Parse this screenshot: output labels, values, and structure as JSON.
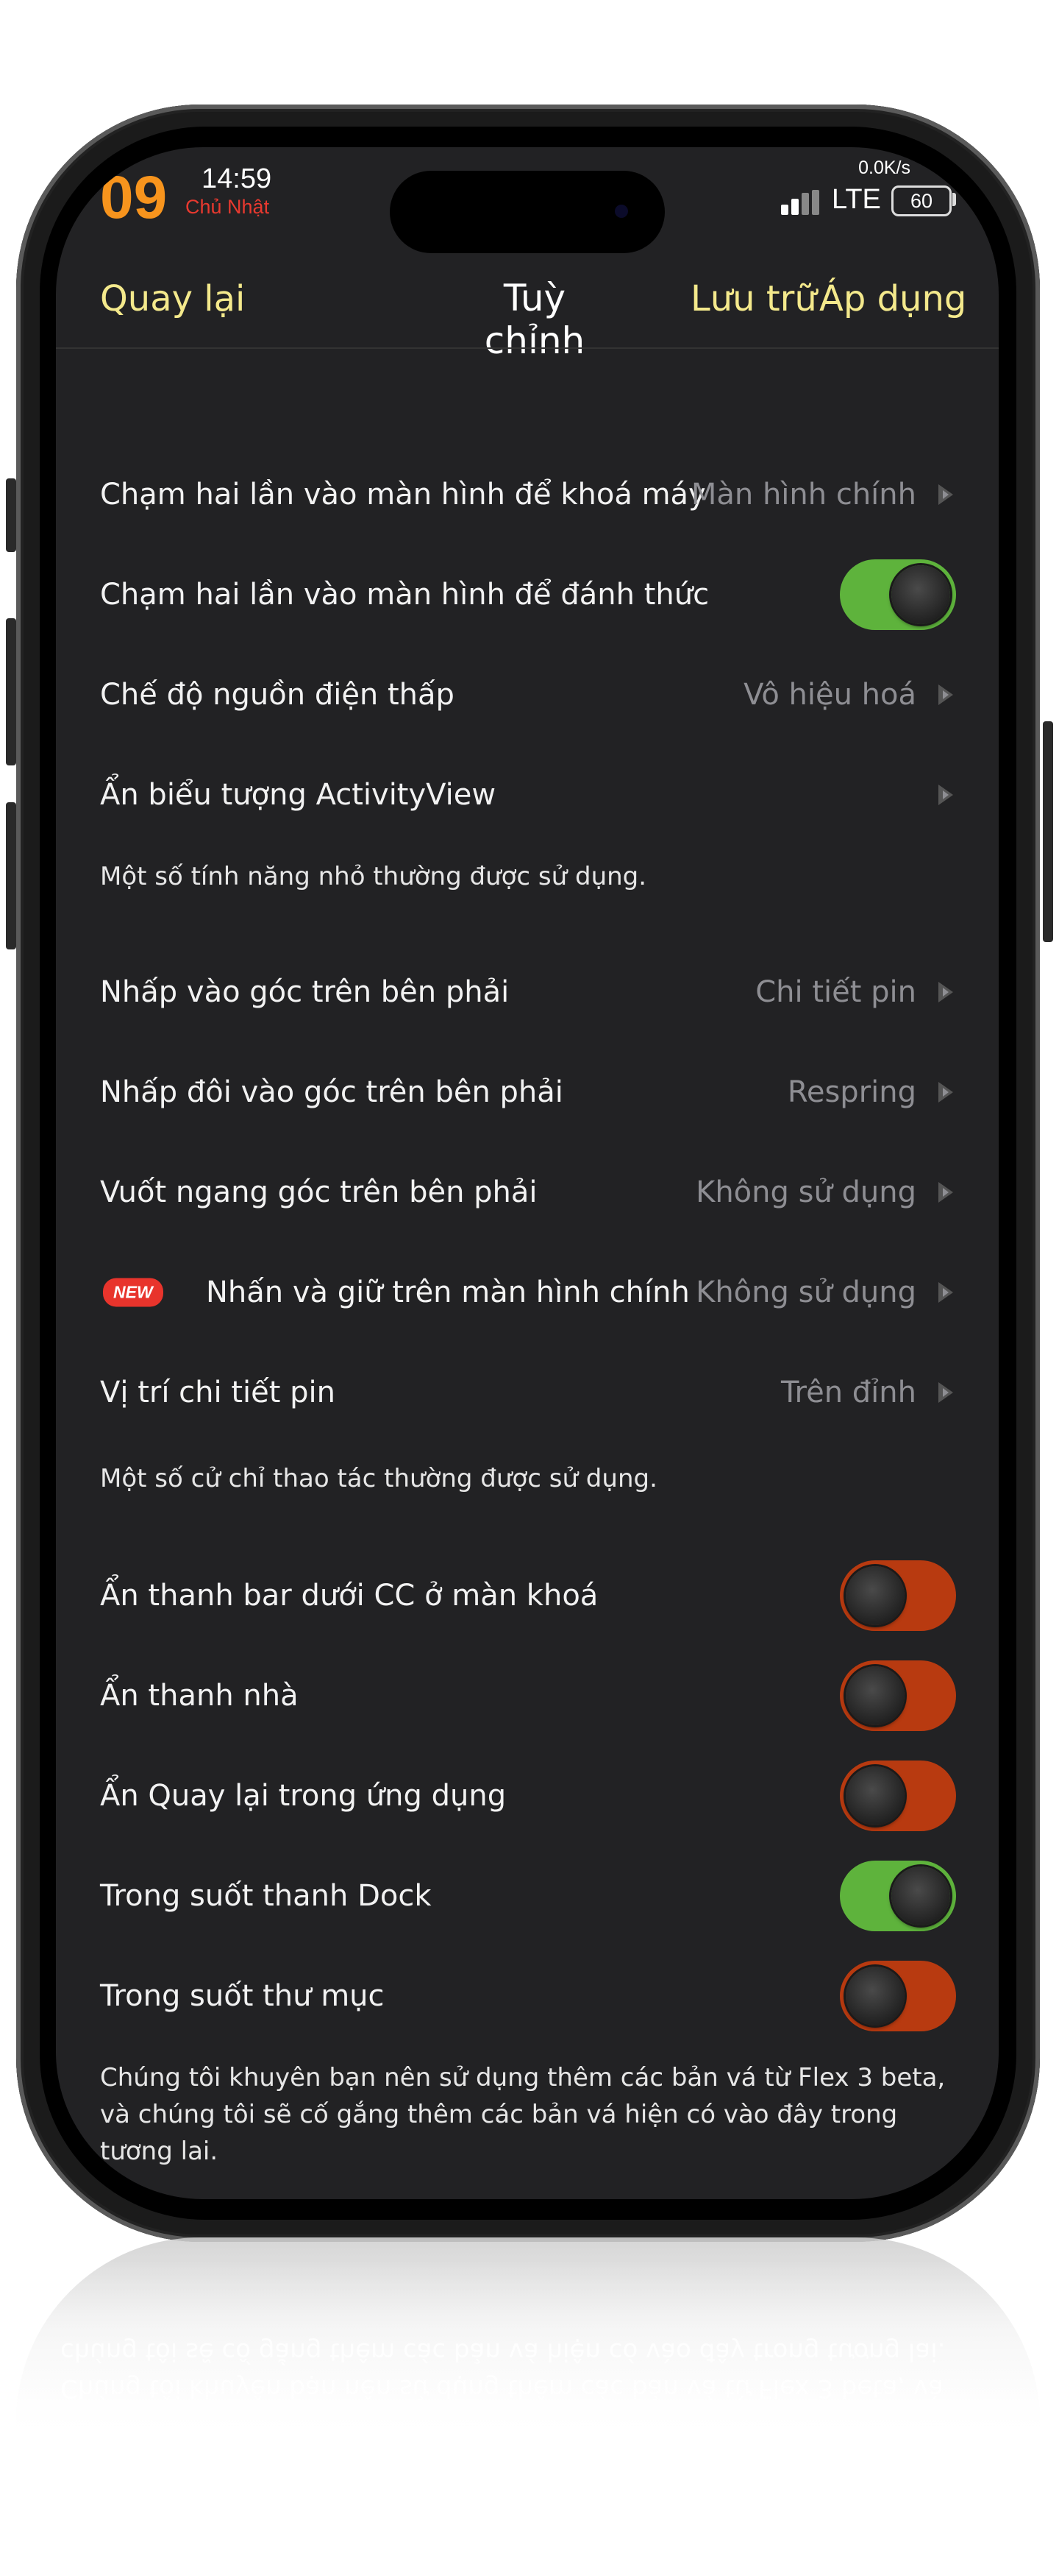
{
  "status_bar": {
    "hour": "09",
    "time": "14:59",
    "day": "Chủ Nhật",
    "net_speed": "0.0K/s",
    "network": "LTE",
    "battery": "60"
  },
  "nav": {
    "back": "Quay lại",
    "title": "Tuỳ chỉnh",
    "archive": "Lưu trữ",
    "apply": "Áp dụng"
  },
  "section1": {
    "rows": [
      {
        "label": "Chạm hai lần vào màn hình để khoá máy",
        "value": "Màn hình chính",
        "type": "arrow"
      },
      {
        "label": "Chạm hai lần vào màn hình để đánh thức",
        "value": "on",
        "type": "toggle"
      },
      {
        "label": "Chế độ nguồn điện thấp",
        "value": "Vô hiệu hoá",
        "type": "arrow"
      },
      {
        "label": "Ẩn biểu tượng ActivityView",
        "value": "",
        "type": "arrow"
      }
    ],
    "footer": "Một số tính năng nhỏ thường được sử dụng."
  },
  "section2": {
    "rows": [
      {
        "label": "Nhấp vào góc trên bên phải",
        "value": "Chi tiết pin",
        "type": "arrow"
      },
      {
        "label": "Nhấp đôi vào góc trên bên phải",
        "value": "Respring",
        "type": "arrow"
      },
      {
        "label": "Vuốt ngang góc trên bên phải",
        "value": "Không sử dụng",
        "type": "arrow"
      },
      {
        "label": "Nhấn và giữ trên màn hình chính",
        "value": "Không sử dụng",
        "type": "arrow",
        "badge": "NEW"
      },
      {
        "label": "Vị trí chi tiết pin",
        "value": "Trên đỉnh",
        "type": "arrow"
      }
    ],
    "footer": "Một số cử chỉ thao tác thường được sử dụng."
  },
  "section3": {
    "rows": [
      {
        "label": "Ẩn thanh bar dưới CC ở màn khoá",
        "value": "off",
        "type": "toggle"
      },
      {
        "label": "Ẩn thanh nhà",
        "value": "off",
        "type": "toggle"
      },
      {
        "label": "Ẩn Quay lại trong ứng dụng",
        "value": "off",
        "type": "toggle"
      },
      {
        "label": "Trong suốt thanh Dock",
        "value": "on",
        "type": "toggle"
      },
      {
        "label": "Trong suốt thư mục",
        "value": "off",
        "type": "toggle"
      }
    ],
    "footer": "Chúng tôi khuyên bạn nên sử dụng thêm các bản vá từ Flex 3 beta, và chúng tôi sẽ cố gắng thêm các bản vá hiện có vào đây trong tương lai."
  },
  "colors": {
    "accent_nav": "#f4e98c",
    "toggle_on": "#5eb33c",
    "toggle_off": "#b83a10",
    "clock_hour": "#f7941d",
    "day_red": "#e8392f",
    "screen_bg": "#222224"
  },
  "icons": {
    "row_arrow": "chevron-right-icon",
    "signal": "signal-bars-icon",
    "battery": "battery-icon"
  }
}
